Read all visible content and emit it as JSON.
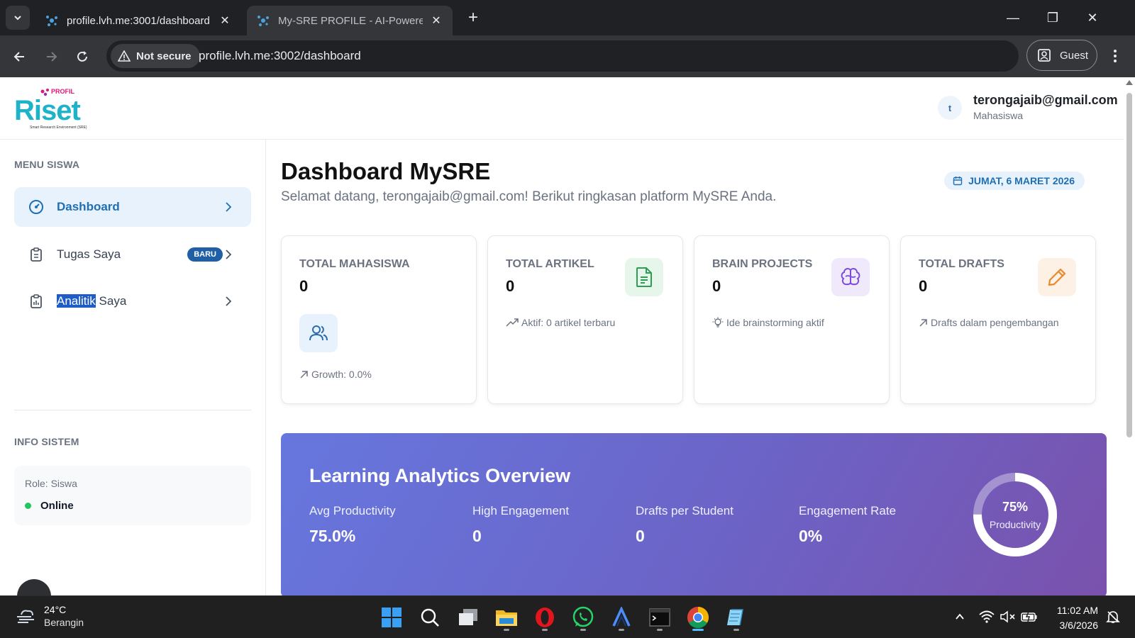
{
  "browser": {
    "tabs": [
      {
        "title": "profile.lvh.me:3001/dashboard",
        "close": "✕"
      },
      {
        "title": "My-SRE PROFILE - AI-Powered I",
        "close": "✕"
      }
    ],
    "new_tab": "+",
    "window_controls": [
      "—",
      "❐",
      "✕"
    ],
    "security_label": "Not secure",
    "url": "profile.lvh.me:3002/dashboard",
    "profile_label": "Guest"
  },
  "header": {
    "logo_small": "PROFIL",
    "logo_main": "Riset",
    "logo_tagline": "Smart Research Environment (SRE)",
    "user_initial": "t",
    "user_email": "terongajaib@gmail.com",
    "user_role": "Mahasiswa"
  },
  "sidebar": {
    "menu_heading": "MENU SISWA",
    "items": [
      {
        "label": "Dashboard",
        "icon": "gauge-icon",
        "active": true
      },
      {
        "label": "Tugas Saya",
        "icon": "clipboard-icon",
        "badge": "BARU"
      },
      {
        "label_highlight": "Analitik",
        "label_rest": " Saya",
        "icon": "clipboard-icon"
      }
    ],
    "info_heading": "INFO SISTEM",
    "info_role": "Role: Siswa",
    "info_status": "Online"
  },
  "main": {
    "title": "Dashboard MySRE",
    "subtitle": "Selamat datang, terongajaib@gmail.com! Berikut ringkasan platform MySRE Anda.",
    "date": "JUMAT, 6 MARET 2026",
    "cards": [
      {
        "label": "TOTAL MAHASISWA",
        "value": "0",
        "footer": "Growth: 0.0%",
        "icon": "users-icon",
        "icon_bg": "#e8f2fc",
        "icon_color": "#2b6cb0"
      },
      {
        "label": "TOTAL ARTIKEL",
        "value": "0",
        "footer": "Aktif: 0 artikel terbaru",
        "icon": "document-icon",
        "icon_bg": "#e6f6ea",
        "icon_color": "#2f9e55"
      },
      {
        "label": "BRAIN PROJECTS",
        "value": "0",
        "footer": "Ide brainstorming aktif",
        "icon": "brain-icon",
        "icon_bg": "#efe9fb",
        "icon_color": "#7c4ddb"
      },
      {
        "label": "TOTAL DRAFTS",
        "value": "0",
        "footer": "Drafts dalam pengembangan",
        "icon": "pencil-icon",
        "icon_bg": "#fdf0e4",
        "icon_color": "#e8892b"
      }
    ],
    "analytics": {
      "title": "Learning Analytics Overview",
      "metrics": [
        {
          "label": "Avg Productivity",
          "value": "75.0%"
        },
        {
          "label": "High Engagement",
          "value": "0"
        },
        {
          "label": "Drafts per Student",
          "value": "0"
        },
        {
          "label": "Engagement Rate",
          "value": "0%"
        }
      ],
      "ring_percent": "75%",
      "ring_fraction": 0.75,
      "ring_label": "Productivity"
    }
  },
  "taskbar": {
    "weather_temp": "24°C",
    "weather_desc": "Berangin",
    "time": "11:02 AM",
    "date": "3/6/2026"
  }
}
